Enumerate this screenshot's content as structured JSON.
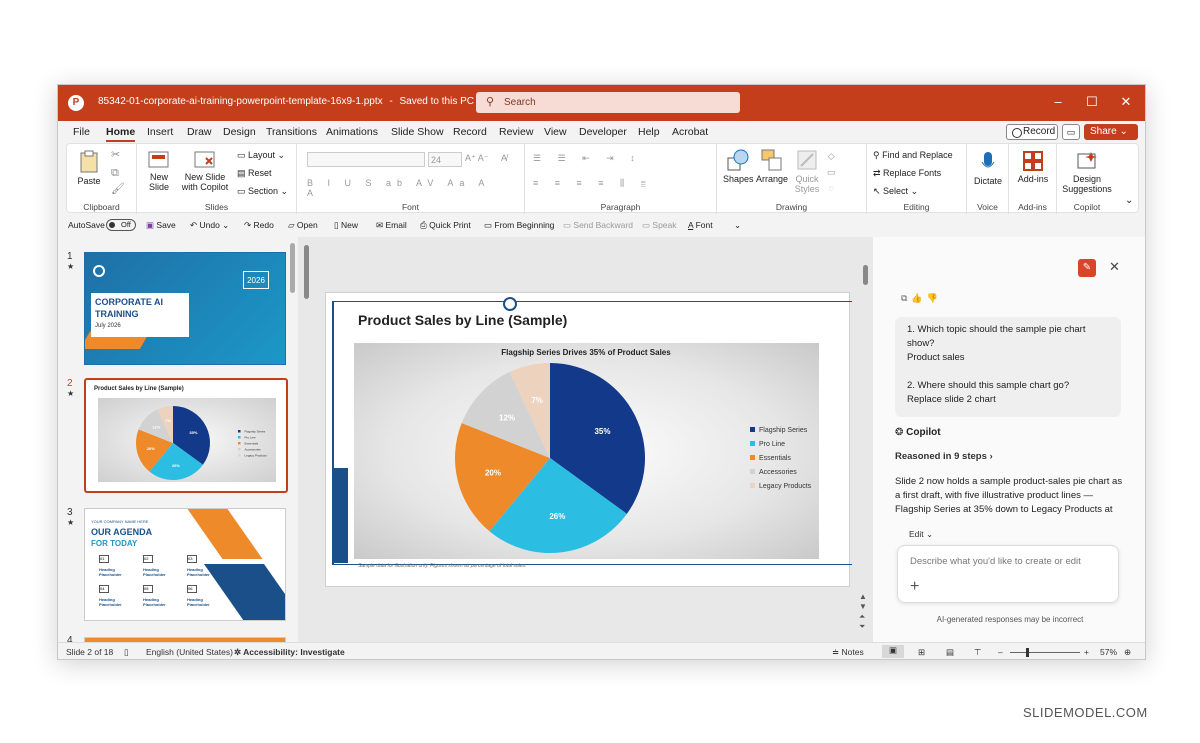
{
  "window": {
    "file_name": "85342-01-corporate-ai-training-powerpoint-template-16x9-1.pptx",
    "saved_state": "Saved to this PC",
    "search_placeholder": "Search"
  },
  "menu": {
    "tabs": [
      "File",
      "Home",
      "Insert",
      "Draw",
      "Design",
      "Transitions",
      "Animations",
      "Slide Show",
      "Record",
      "Review",
      "View",
      "Developer",
      "Help",
      "Acrobat"
    ],
    "record_label": "Record",
    "share_label": "Share"
  },
  "ribbon": {
    "clipboard": {
      "label": "Clipboard",
      "paste": "Paste"
    },
    "slides": {
      "label": "Slides",
      "new_slide_1": "New",
      "new_slide_2": "Slide",
      "copilot_1": "New Slide",
      "copilot_2": "with Copilot",
      "layout": "Layout",
      "reset": "Reset",
      "section": "Section"
    },
    "font": {
      "label": "Font",
      "size": "24"
    },
    "paragraph": {
      "label": "Paragraph"
    },
    "drawing": {
      "label": "Drawing",
      "shapes": "Shapes",
      "arrange": "Arrange",
      "quick_1": "Quick",
      "quick_2": "Styles"
    },
    "editing": {
      "label": "Editing",
      "find": "Find and Replace",
      "replace": "Replace Fonts",
      "select": "Select"
    },
    "voice": {
      "label": "Voice",
      "dictate": "Dictate"
    },
    "addins": {
      "label": "Add-ins",
      "addins": "Add-ins"
    },
    "copilot": {
      "label": "Copilot",
      "design_1": "Design",
      "design_2": "Suggestions"
    }
  },
  "qat": {
    "autosave": "AutoSave",
    "off": "Off",
    "save": "Save",
    "undo": "Undo",
    "redo": "Redo",
    "open": "Open",
    "new": "New",
    "email": "Email",
    "quick_print": "Quick Print",
    "from_beginning": "From Beginning",
    "send_backward": "Send Backward",
    "speak": "Speak",
    "font": "Font"
  },
  "thumbnails": [
    {
      "num": "1",
      "title_1": "CORPORATE AI",
      "title_2": "TRAINING",
      "date": "July 2026",
      "year": "2026"
    },
    {
      "num": "2",
      "title": "Product Sales by Line (Sample)"
    },
    {
      "num": "3",
      "company": "YOUR COMPANY NAME HERE",
      "title_1": "OUR AGENDA",
      "title_2": "FOR TODAY",
      "items": [
        "01",
        "02",
        "03",
        "04",
        "05",
        "06"
      ],
      "heading": "Heading",
      "placeholder": "Placeholder"
    },
    {
      "num": "4"
    }
  ],
  "slide": {
    "title": "Product Sales by Line (Sample)",
    "footnote": "Sample data for illustration only. Figures shown as percentage of total sales."
  },
  "chart_data": {
    "type": "pie",
    "title": "Flagship Series Drives 35% of Product Sales",
    "categories": [
      "Flagship Series",
      "Pro Line",
      "Essentials",
      "Accessories",
      "Legacy Products"
    ],
    "values": [
      35,
      26,
      20,
      12,
      7
    ],
    "colors": [
      "#13398a",
      "#2cbde3",
      "#ef8a2a",
      "#d2d2d2",
      "#edd2bd"
    ],
    "label_colors": [
      "#ffffff",
      "#ffffff",
      "#ffffff",
      "#ffffff",
      "#ffffff"
    ],
    "legend_position": "right"
  },
  "copilot": {
    "q1": "1. Which topic should the sample pie chart show?",
    "a1": "Product sales",
    "q2": "2. Where should this sample chart go?",
    "a2": "Replace slide 2 chart",
    "name": "Copilot",
    "reasoned": "Reasoned in 9 steps",
    "response": "Slide 2 now holds a sample product-sales pie chart as a first draft, with five illustrative product lines — Flagship Series at 35% down to Legacy Products at",
    "edit": "Edit",
    "input_placeholder": "Describe what you'd like to create or edit",
    "disclaimer": "AI-generated responses may be incorrect"
  },
  "status": {
    "slide": "Slide 2 of 18",
    "language": "English (United States)",
    "accessibility": "Accessibility: Investigate",
    "notes": "Notes",
    "zoom": "57%"
  },
  "watermark": "SLIDEMODEL.COM"
}
